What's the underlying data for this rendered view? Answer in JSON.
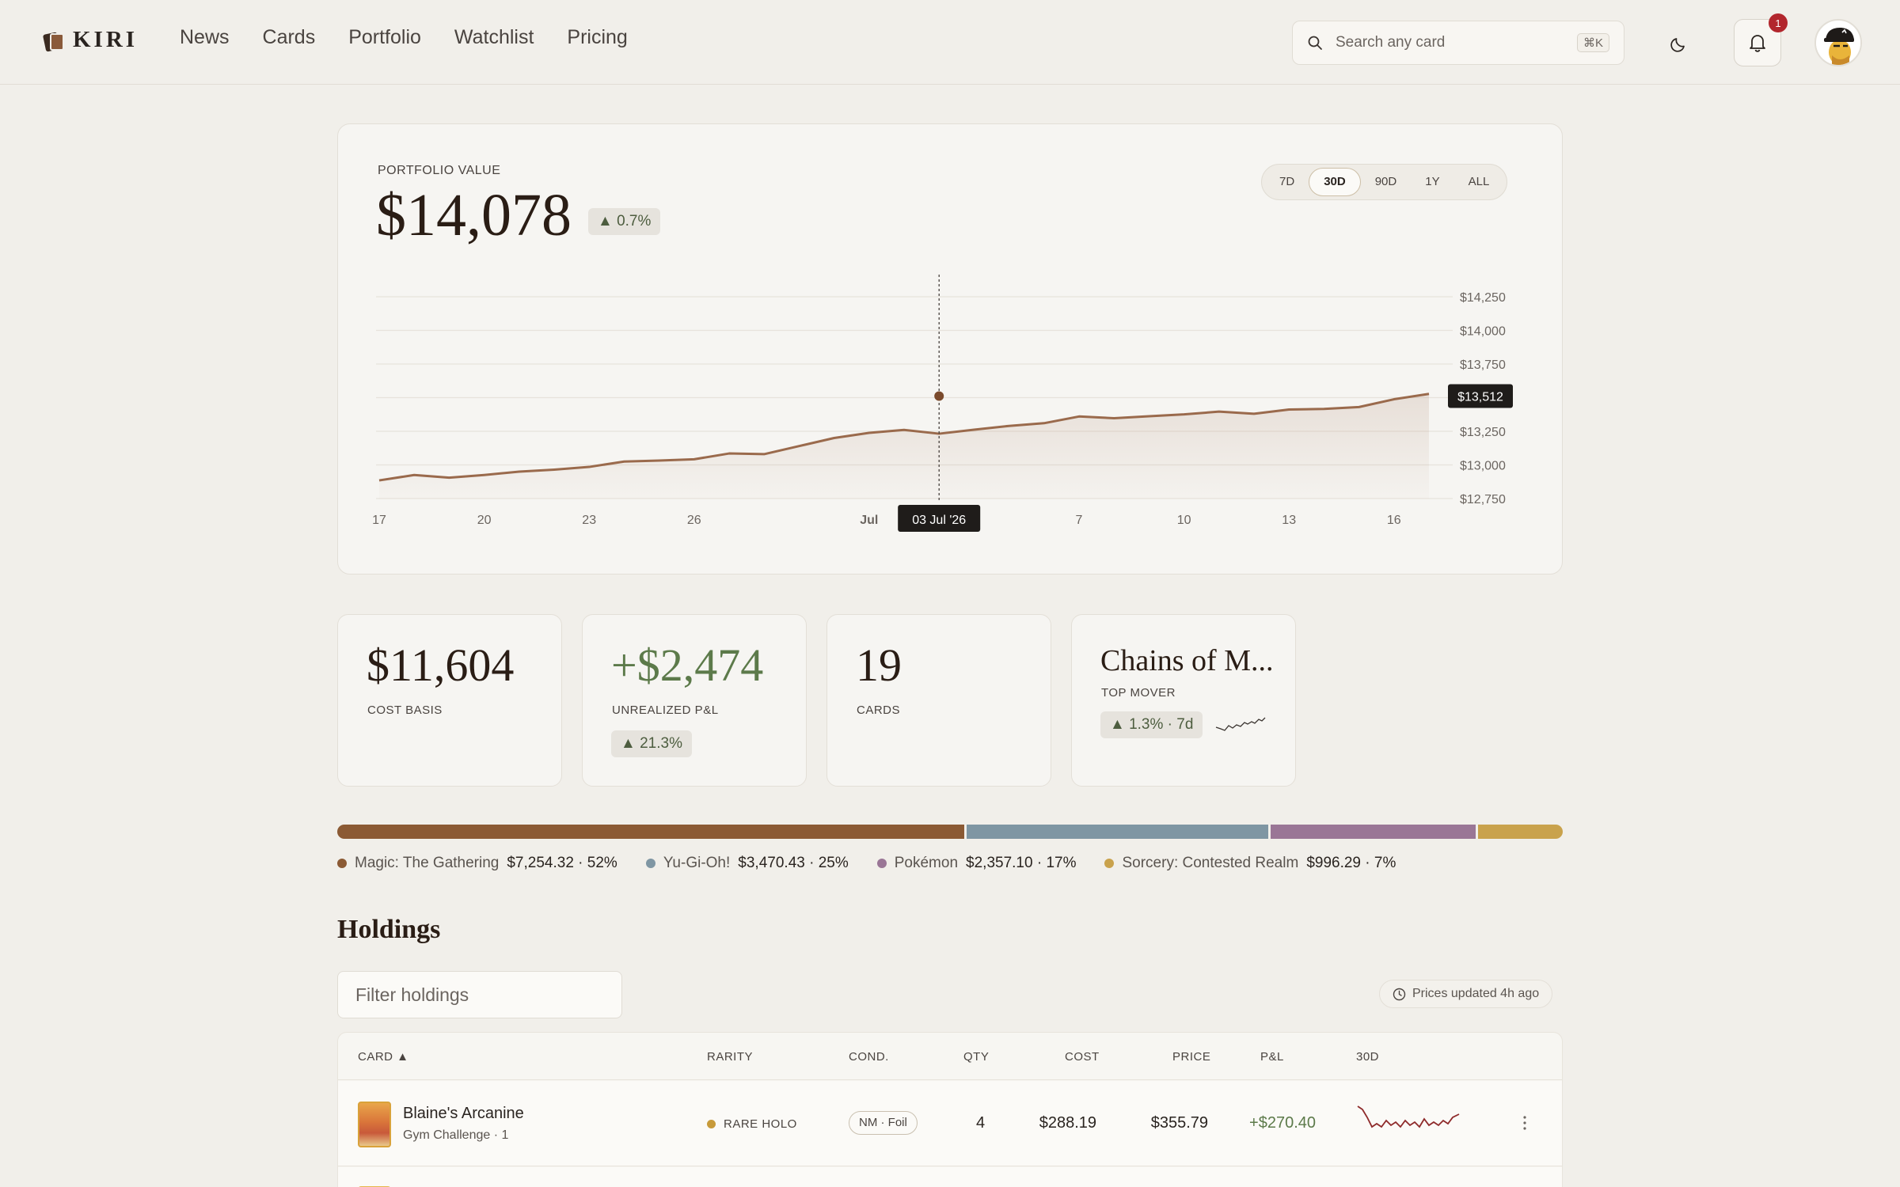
{
  "brand": {
    "name": "KIRI"
  },
  "nav": {
    "items": [
      "News",
      "Cards",
      "Portfolio",
      "Watchlist",
      "Pricing"
    ]
  },
  "search": {
    "placeholder": "Search any card",
    "shortcut": "⌘K"
  },
  "notifications": {
    "count": "1"
  },
  "portfolio": {
    "label": "PORTFOLIO VALUE",
    "value": "$14,078",
    "change": "▲ 0.7%",
    "ranges": [
      "7D",
      "30D",
      "90D",
      "1Y",
      "ALL"
    ],
    "active_range": "30D",
    "tooltip_value": "$13,512",
    "tooltip_date": "03 Jul '26"
  },
  "chart_data": {
    "type": "area",
    "x": [
      "2026-06-17",
      "2026-06-18",
      "2026-06-19",
      "2026-06-20",
      "2026-06-21",
      "2026-06-22",
      "2026-06-23",
      "2026-06-24",
      "2026-06-25",
      "2026-06-26",
      "2026-06-27",
      "2026-06-28",
      "2026-06-29",
      "2026-06-30",
      "2026-07-01",
      "2026-07-02",
      "2026-07-03",
      "2026-07-04",
      "2026-07-05",
      "2026-07-06",
      "2026-07-07",
      "2026-07-08",
      "2026-07-09",
      "2026-07-10",
      "2026-07-11",
      "2026-07-12",
      "2026-07-13",
      "2026-07-14",
      "2026-07-15",
      "2026-07-16",
      "2026-07-17"
    ],
    "values": [
      12885,
      12925,
      12905,
      12925,
      12950,
      12965,
      12985,
      13025,
      13032,
      13042,
      13085,
      13080,
      13140,
      13200,
      13238,
      13260,
      13232,
      13262,
      13290,
      13310,
      13360,
      13347,
      13362,
      13376,
      13396,
      13380,
      13412,
      13416,
      13430,
      13488,
      13528
    ],
    "ylim": [
      12750,
      14250
    ],
    "yticks": [
      12750,
      13000,
      13250,
      13750,
      14000,
      14250
    ],
    "ytick_labels": [
      "$12,750",
      "$13,000",
      "$13,250",
      "$13,750",
      "$14,000",
      "$14,250"
    ],
    "xtick_labels": [
      "17",
      "20",
      "23",
      "26",
      "Jul",
      "7",
      "10",
      "13",
      "16"
    ],
    "xtick_dates": [
      "2026-06-17",
      "2026-06-20",
      "2026-06-23",
      "2026-06-26",
      "2026-07-01",
      "2026-07-07",
      "2026-07-10",
      "2026-07-13",
      "2026-07-16"
    ],
    "highlight": {
      "x": "2026-07-03",
      "value": 13512
    },
    "grid": true,
    "color": "#9a6a4c"
  },
  "stats": {
    "cost_basis": {
      "value": "$11,604",
      "label": "COST BASIS"
    },
    "unrealized": {
      "value": "+$2,474",
      "label": "UNREALIZED P&L",
      "change": "▲ 21.3%"
    },
    "cards": {
      "value": "19",
      "label": "CARDS"
    },
    "top_mover": {
      "name": "Chains of M...",
      "label": "TOP MOVER",
      "change": "▲ 1.3% · 7d"
    }
  },
  "allocation": [
    {
      "name": "Magic: The Gathering",
      "value": "$7,254.32 · 52%",
      "share": 52,
      "color": "#8b5a34"
    },
    {
      "name": "Yu-Gi-Oh!",
      "value": "$3,470.43 · 25%",
      "share": 25,
      "color": "#7f96a3"
    },
    {
      "name": "Pokémon",
      "value": "$2,357.10 · 17%",
      "share": 17,
      "color": "#9a7696"
    },
    {
      "name": "Sorcery: Contested Realm",
      "value": "$996.29 · 7%",
      "share": 7,
      "color": "#c9a24c"
    }
  ],
  "holdings": {
    "title": "Holdings",
    "filter_placeholder": "Filter holdings",
    "updated": "Prices updated 4h ago",
    "columns": {
      "card": "CARD ▲",
      "rarity": "RARITY",
      "cond": "COND.",
      "qty": "QTY",
      "cost": "COST",
      "price": "PRICE",
      "pl": "P&L",
      "spark": "30D"
    },
    "rows": [
      {
        "name": "Blaine's Arcanine",
        "set": "Gym Challenge · 1",
        "rarity": "RARE HOLO",
        "cond": "NM · Foil",
        "qty": "4",
        "cost": "$288.19",
        "price": "$355.79",
        "pl": "+$270.40"
      }
    ]
  }
}
